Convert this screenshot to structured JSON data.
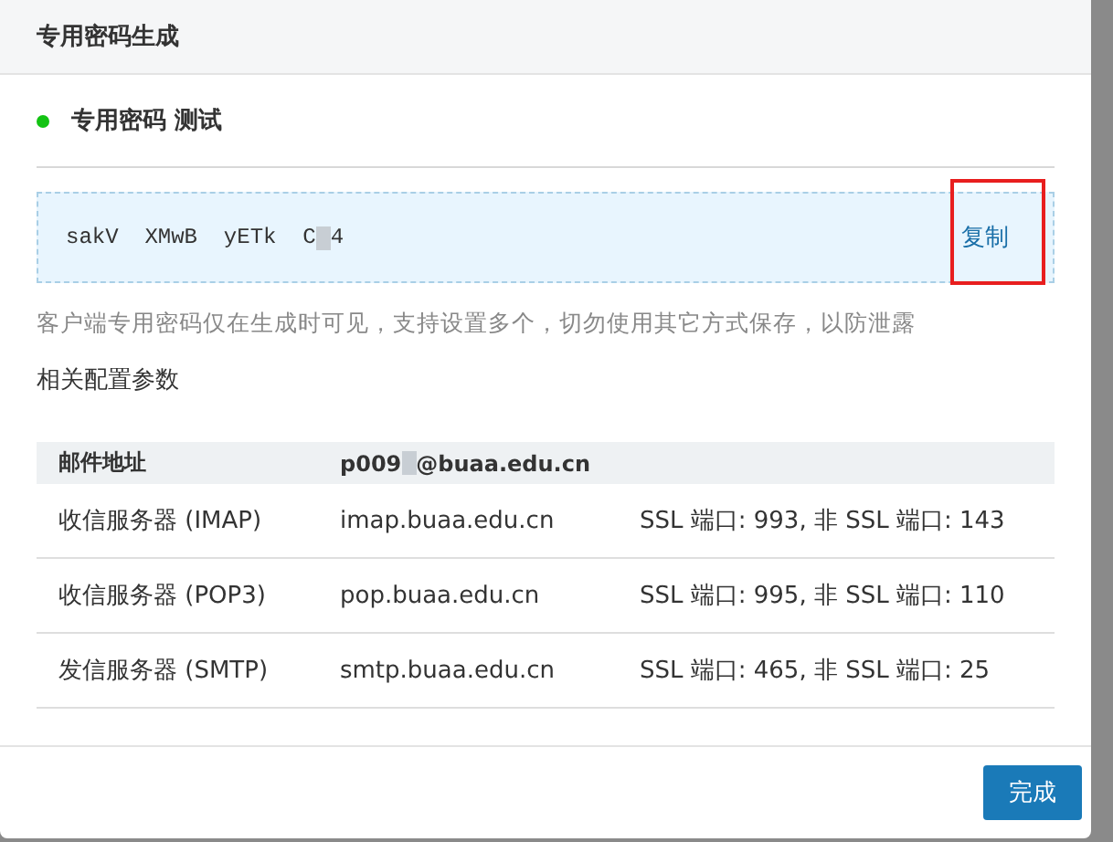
{
  "dialog": {
    "title": "专用密码生成"
  },
  "password_name": {
    "active": true,
    "label": "专用密码 测试"
  },
  "password": {
    "shown_before": "sakV  XMwB  yETk  C",
    "shown_after": "4",
    "copy_label": "复制",
    "copy_highlighted": true
  },
  "hint": "客户端专用密码仅在生成时可见，支持设置多个，切勿使用其它方式保存，以防泄露",
  "section_title": "相关配置参数",
  "table": {
    "header": {
      "label": "邮件地址",
      "address_before": "p009",
      "address_after": "@buaa.edu.cn"
    },
    "rows": [
      {
        "server": "收信服务器 (IMAP)",
        "host": "imap.buaa.edu.cn",
        "ports": "SSL 端口: 993, 非 SSL 端口: 143"
      },
      {
        "server": "收信服务器 (POP3)",
        "host": "pop.buaa.edu.cn",
        "ports": "SSL 端口: 995, 非 SSL 端口: 110"
      },
      {
        "server": "发信服务器 (SMTP)",
        "host": "smtp.buaa.edu.cn",
        "ports": "SSL 端口: 465, 非 SSL 端口: 25"
      }
    ]
  },
  "buttons": [
    {
      "label": "完成"
    }
  ]
}
